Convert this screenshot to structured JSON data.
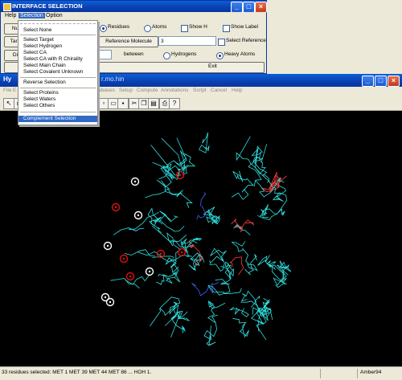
{
  "dialog": {
    "title": "INTERFACE SELECTION",
    "menu": [
      "Help",
      "Selection",
      "Option"
    ],
    "row1": {
      "radio_residues": "Residues",
      "radio_atoms": "Atoms",
      "check_show_h": "Show H",
      "check_show_label": "Show Label"
    },
    "row2": {
      "button_reference_molecule": "Reference Molecule",
      "reference_value": "3",
      "check_select_reference": "Select Reference"
    },
    "row3": {
      "between_label": "between",
      "radio_hydrogens": "Hydrogens",
      "radio_heavy_atoms": "Heavy Atoms"
    },
    "exit_label": "Exit",
    "cut_labels": {
      "row1": "Nu",
      "row2": "Targ",
      "row3": "Di"
    }
  },
  "dropdown": {
    "group1": [
      "Select None"
    ],
    "group2": [
      "Select Target",
      "Select Hydrogen",
      "Select CA",
      "Select CA with R Chirality",
      "Select Main Chain",
      "Select Covalent Unknown"
    ],
    "group3": [
      "Reverse Selection"
    ],
    "group4": [
      "Select Proteins",
      "Select Waters",
      "Select Others"
    ],
    "group5": [
      "Complement Selection"
    ],
    "highlighted": "Complement Selection"
  },
  "main_window": {
    "title_visible": "Hy",
    "title_file": "r.mo.hin",
    "menu_left": [
      "File",
      "E"
    ],
    "menu_right": [
      "abases",
      "Setup",
      "Compute",
      "Annotations",
      "Script",
      "Cancel",
      "Help"
    ],
    "toolbar_left": [
      "select-tool",
      "rotate-tool"
    ],
    "toolbar_right": [
      "new-file",
      "open-file",
      "save-file",
      "cut",
      "copy",
      "paste",
      "print",
      "help-pointer"
    ],
    "status_text": "33 residues selected: MET 1 MET 39 MET 44 MET 86 ... HOH 1.",
    "status_right": "Amber94"
  },
  "colors": {
    "title_bar": "#0a3fb0",
    "menu_highlight": "#316ac5",
    "canvas_bg": "#000000",
    "molecule": "#30e0e0",
    "selected_marker": "#e01010",
    "water_marker": "#ffffff"
  }
}
